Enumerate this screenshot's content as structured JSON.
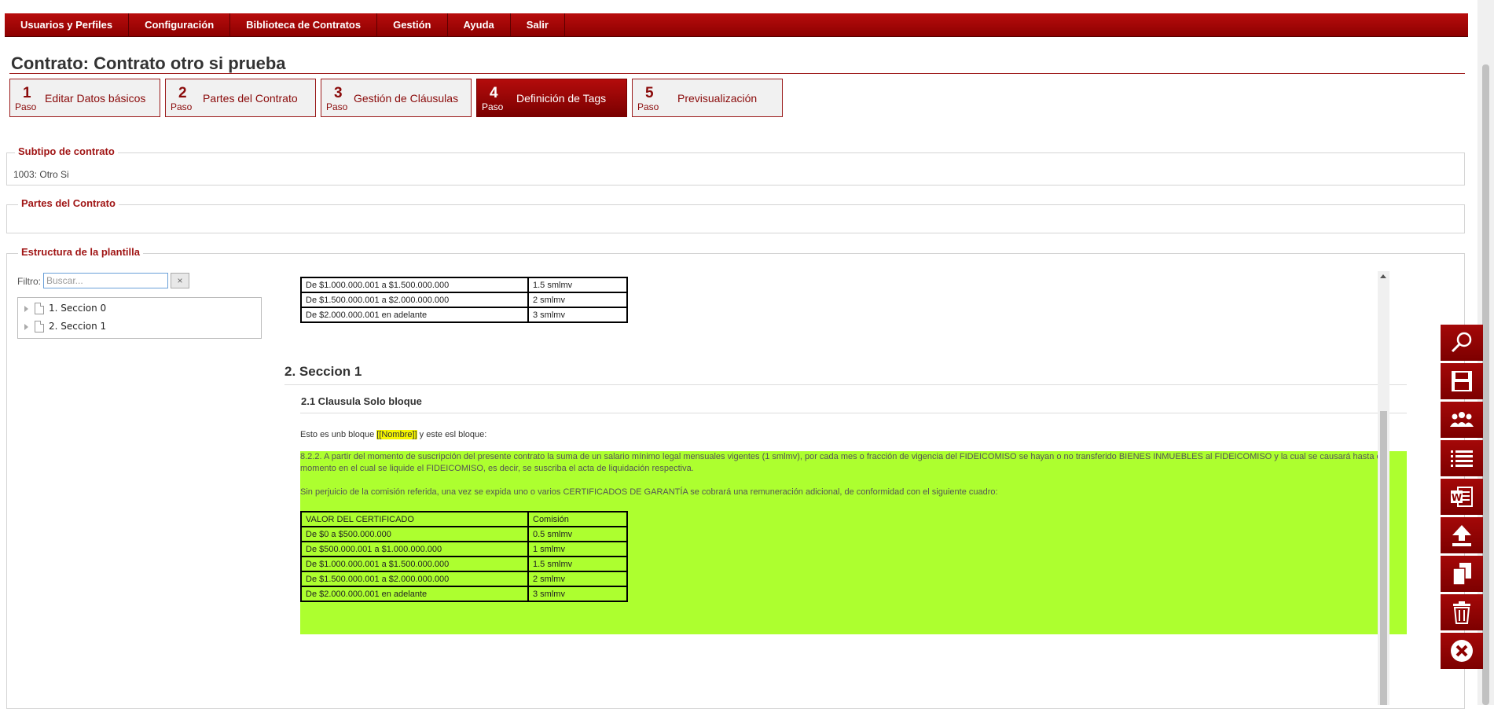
{
  "menu": [
    {
      "label": "Usuarios y Perfiles"
    },
    {
      "label": "Configuración"
    },
    {
      "label": "Biblioteca de Contratos"
    },
    {
      "label": "Gestión"
    },
    {
      "label": "Ayuda"
    },
    {
      "label": "Salir"
    }
  ],
  "page_title": "Contrato: Contrato otro si prueba",
  "steps": [
    {
      "num": "1",
      "paso": "Paso",
      "label": "Editar Datos básicos"
    },
    {
      "num": "2",
      "paso": "Paso",
      "label": "Partes del Contrato"
    },
    {
      "num": "3",
      "paso": "Paso",
      "label": "Gestión de Cláusulas"
    },
    {
      "num": "4",
      "paso": "Paso",
      "label": "Definición de Tags",
      "active": true
    },
    {
      "num": "5",
      "paso": "Paso",
      "label": "Previsualización"
    }
  ],
  "subtipo": {
    "legend": "Subtipo de contrato",
    "value": "1003: Otro Si"
  },
  "partes": {
    "legend": "Partes del Contrato"
  },
  "estructura": {
    "legend": "Estructura de la plantilla",
    "filter_label": "Filtro:",
    "filter_placeholder": "Buscar...",
    "filter_clear": "×",
    "tree": [
      {
        "label": "1. Seccion 0"
      },
      {
        "label": "2. Seccion 1"
      }
    ]
  },
  "content": {
    "top_table": [
      [
        "De $1.000.000.001 a $1.500.000.000",
        "1.5 smlmv"
      ],
      [
        "De $1.500.000.001 a $2.000.000.000",
        "2 smlmv"
      ],
      [
        "De $2.000.000.001 en adelante",
        "3 smlmv"
      ]
    ],
    "section_title": "2. Seccion 1",
    "clause_title": "2.1 Clausula Solo bloque",
    "block_text_before": "Esto es unb bloque ",
    "block_tag": "[[Nombre]]",
    "block_text_after": " y este esl bloque:",
    "paragraph1": "8.2.2. A partir del momento de suscripción del presente contrato la suma de un salario mínimo legal mensuales vigentes (1 smlmv), por cada mes o fracción de vigencia del FIDEICOMISO se hayan o no transferido BIENES INMUEBLES al FIDEICOMISO y la cual se causará hasta el momento en el cual se liquide el FIDEICOMISO, es decir, se suscriba el acta de liquidación respectiva.",
    "paragraph2": "Sin perjuicio de la comisión referida, una vez se expida uno o varios CERTIFICADOS DE GARANTÍA se cobrará una remuneración adicional, de conformidad con el siguiente cuadro:",
    "green_table": [
      [
        "VALOR DEL CERTIFICADO",
        "Comisión"
      ],
      [
        "De $0 a $500.000.000",
        "0.5 smlmv"
      ],
      [
        "De $500.000.001 a $1.000.000.000",
        "1 smlmv"
      ],
      [
        "De $1.000.000.001 a $1.500.000.000",
        "1.5 smlmv"
      ],
      [
        "De $1.500.000.001 a $2.000.000.000",
        "2 smlmv"
      ],
      [
        "De $2.000.000.001 en adelante",
        "3 smlmv"
      ]
    ],
    "highlight_color": "#adff2f",
    "tag_color": "#f5f500"
  },
  "toolbar": [
    {
      "icon": "search-icon"
    },
    {
      "icon": "save-icon"
    },
    {
      "icon": "users-icon"
    },
    {
      "icon": "list-icon"
    },
    {
      "icon": "word-icon"
    },
    {
      "icon": "upload-icon"
    },
    {
      "icon": "copy-icon"
    },
    {
      "icon": "trash-icon"
    },
    {
      "icon": "close-icon"
    }
  ],
  "colors": {
    "brand": "#a40808",
    "accent_text": "#a01515"
  }
}
